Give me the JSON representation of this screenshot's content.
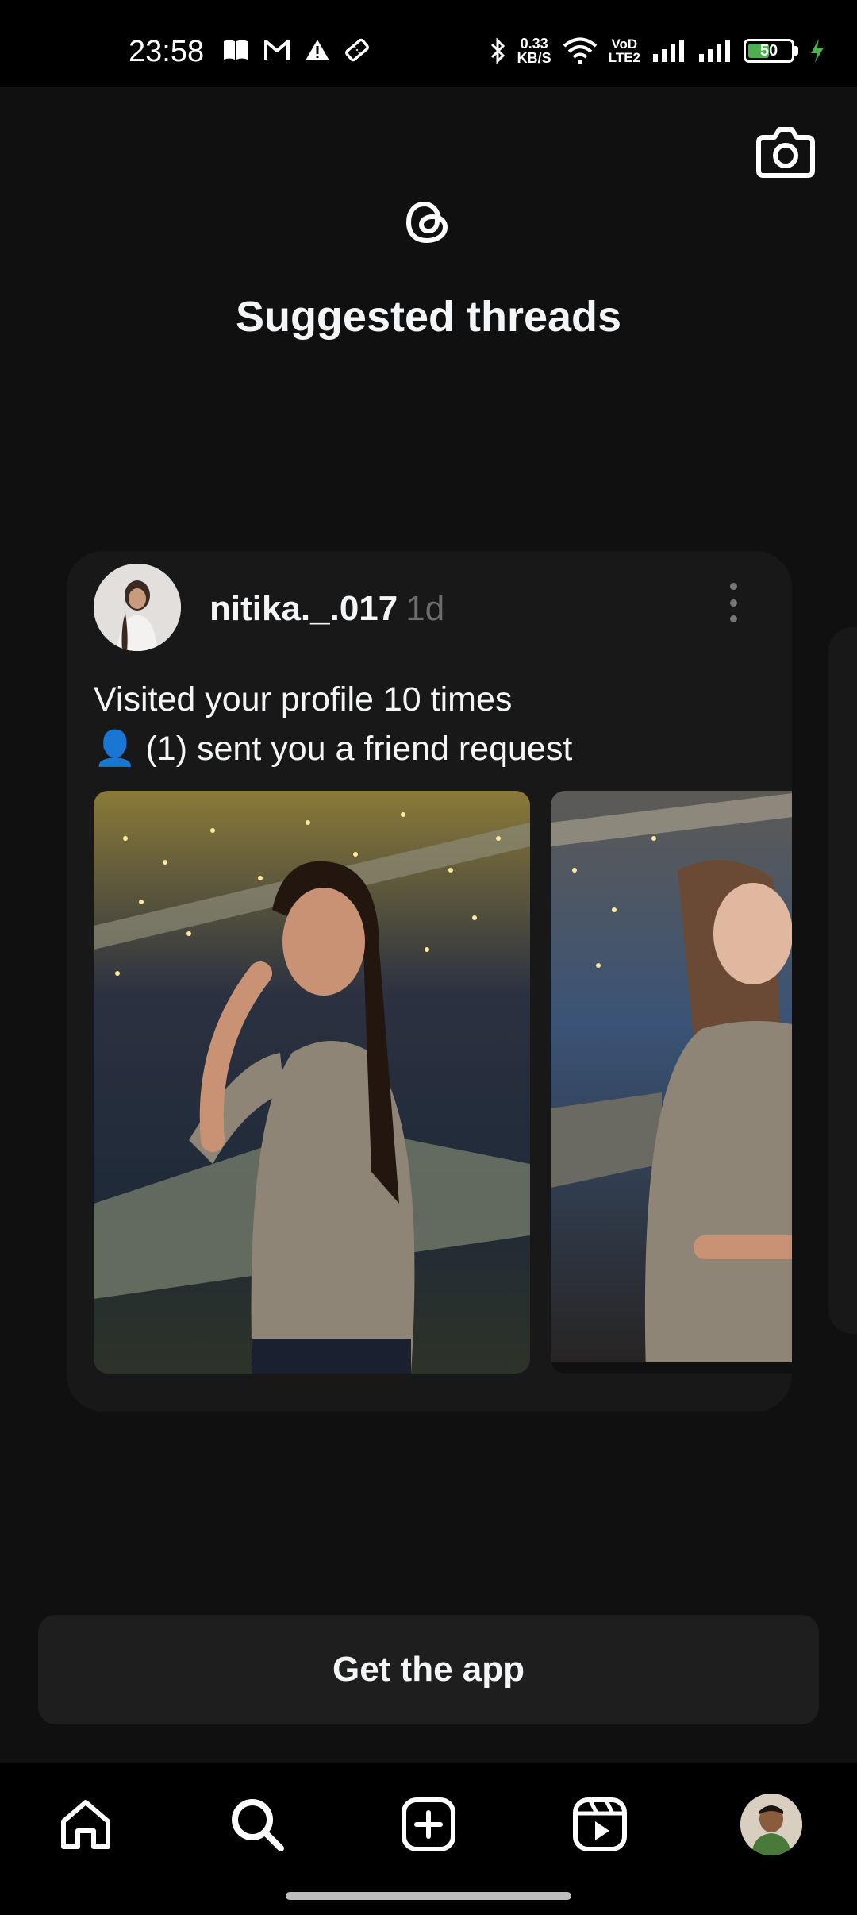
{
  "status_bar": {
    "time": "23:58",
    "speed_value": "0.33",
    "speed_unit": "KB/S",
    "net_top": "VoD",
    "net_bottom": "LTE2",
    "battery": "50",
    "battery_level": 0.5
  },
  "header": {
    "title": "Suggested threads"
  },
  "post": {
    "username": "nitika._.017",
    "time": "1d",
    "line1": "Visited your profile 10 times",
    "line2": "👤 (1) sent you a friend request"
  },
  "cta": {
    "label": "Get the app"
  },
  "nav": {
    "items": [
      "home-icon",
      "search-icon",
      "create-icon",
      "reels-icon",
      "profile-avatar"
    ]
  },
  "colors": {
    "background": "#101010",
    "card": "#181818",
    "battery_charge": "#4caf50"
  }
}
